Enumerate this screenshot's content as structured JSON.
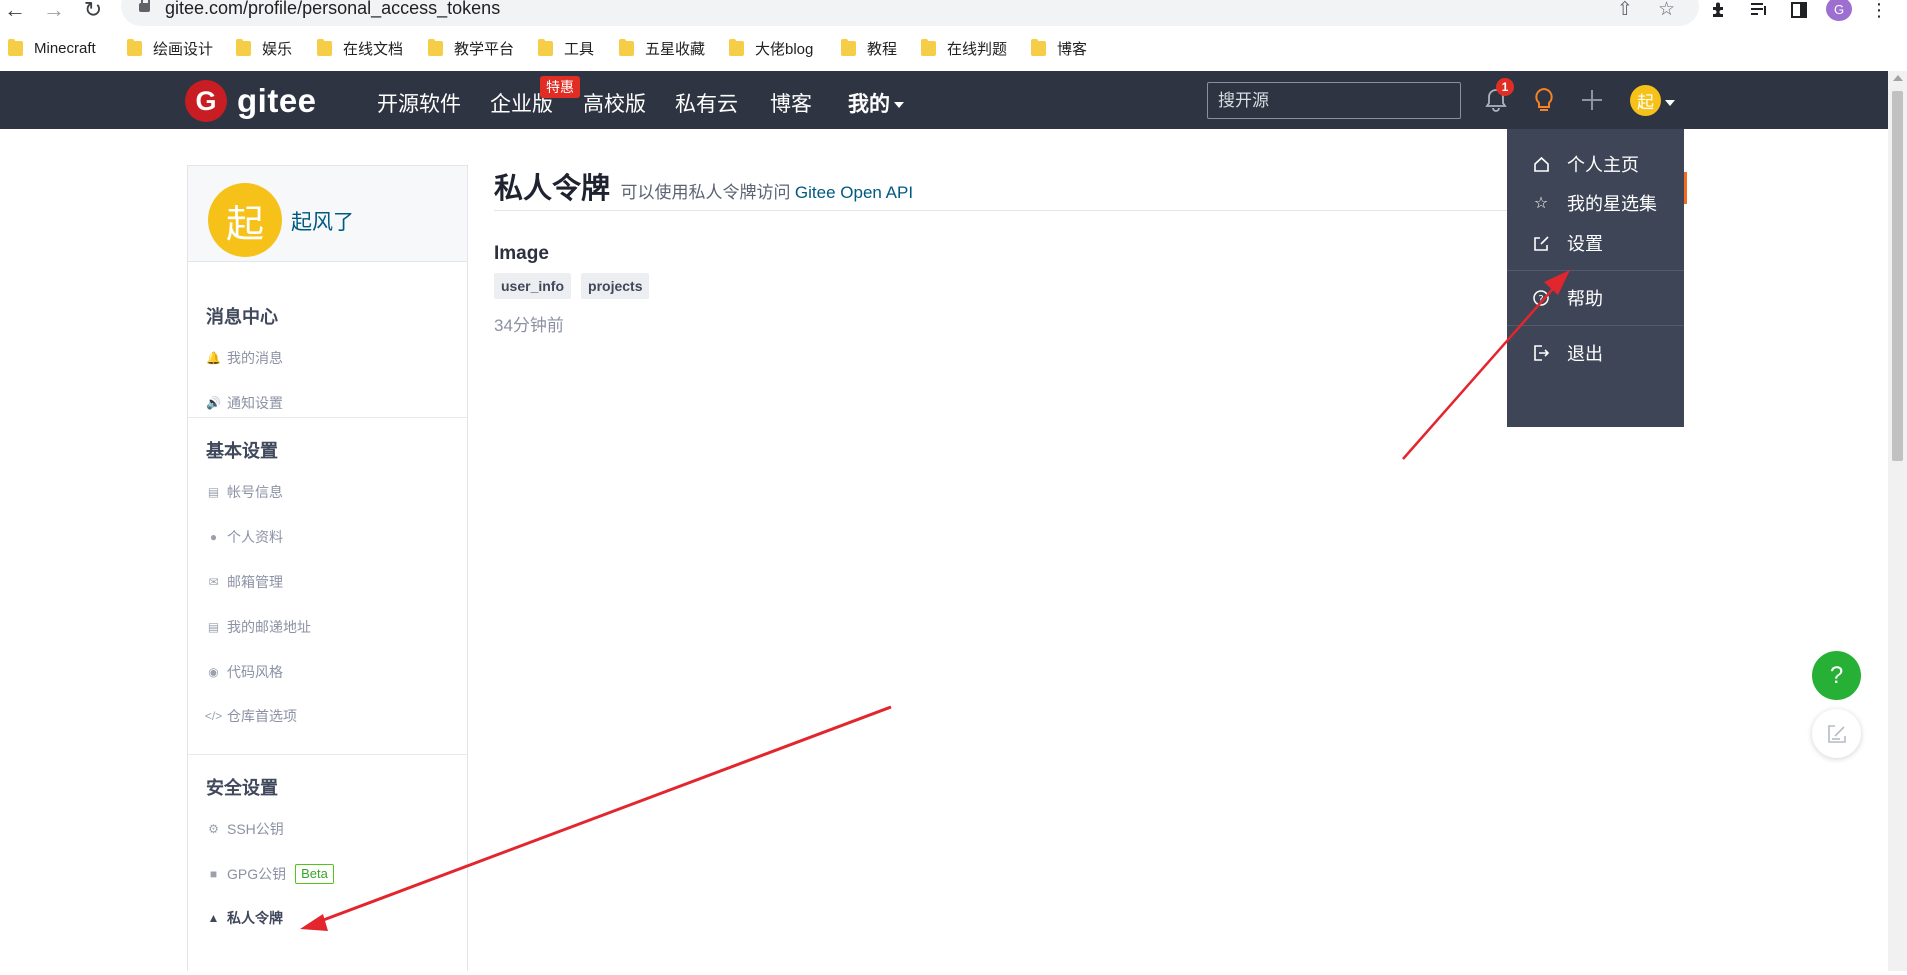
{
  "browser": {
    "url": "gitee.com/profile/personal_access_tokens",
    "bookmarks": [
      "Minecraft",
      "绘画设计",
      "娱乐",
      "在线文档",
      "教学平台",
      "工具",
      "五星收藏",
      "大佬blog",
      "教程",
      "在线判题",
      "博客"
    ],
    "profile_initial": "G"
  },
  "topbar": {
    "logo_mark": "G",
    "logo_text": "gitee",
    "nav": [
      "开源软件",
      "企业版",
      "高校版",
      "私有云",
      "博客",
      "我的"
    ],
    "promo_badge": "特惠",
    "search_placeholder": "搜开源",
    "notification_count": "1",
    "avatar_initial": "起"
  },
  "user_menu": {
    "items": [
      "个人主页",
      "我的星选集",
      "设置",
      "帮助",
      "退出"
    ]
  },
  "sidebar": {
    "avatar_initial": "起",
    "username": "起风了",
    "sections": [
      {
        "title": "消息中心",
        "items": [
          "我的消息",
          "通知设置"
        ]
      },
      {
        "title": "基本设置",
        "items": [
          "帐号信息",
          "个人资料",
          "邮箱管理",
          "我的邮递地址",
          "代码风格",
          "仓库首选项"
        ]
      },
      {
        "title": "安全设置",
        "items": [
          "SSH公钥",
          "GPG公钥",
          "私人令牌"
        ],
        "beta_tag": "Beta"
      }
    ]
  },
  "main": {
    "title": "私人令牌",
    "subtitle": "可以使用私人令牌访问",
    "subtitle_link": "Gitee Open API",
    "token": {
      "name": "Image",
      "scopes": [
        "user_info",
        "projects"
      ],
      "created": "34分钟前"
    }
  },
  "floating": {
    "help_label": "?"
  },
  "colors": {
    "topbar_bg": "#2e3441",
    "menu_bg": "#3e4556",
    "brand_red": "#c71d23",
    "avatar_yellow": "#f6c21a",
    "link_blue": "#005980",
    "annotation_red": "#e3262d",
    "help_green": "#27b036",
    "beta_green": "#52c41a"
  }
}
